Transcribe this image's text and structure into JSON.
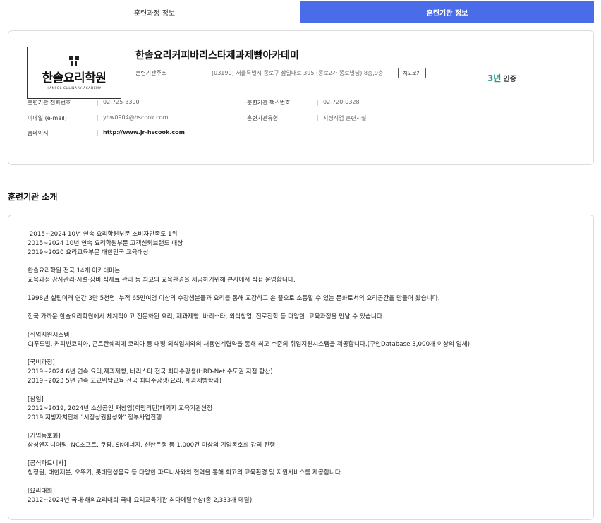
{
  "tabs": [
    {
      "label": "훈련과정 정보",
      "active": false
    },
    {
      "label": "훈련기관 정보",
      "active": true
    }
  ],
  "institution": {
    "logo_name": "한솔요리학원",
    "logo_sub": "HANSOL CULINARY ACADEMY",
    "name": "한솔요리커피바리스타제과제빵아카데미",
    "address_label": "훈련기관주소",
    "address": "(03190) 서울특별시 종로구 삼일대로 395 (종로2가 종로빌딩) 8층,9층",
    "map_button": "지도보기",
    "cert_years": "3년",
    "cert_label": "인증",
    "phone_label": "훈련기관 전화번호",
    "phone": "02-725-3300",
    "fax_label": "훈련기관 팩스번호",
    "fax": "02-720-0328",
    "email_label": "이메일 (e-mail)",
    "email": "yhw0904@hscook.com",
    "type_label": "훈련기관유형",
    "type": "지정직업 훈련시설",
    "homepage_label": "홈페이지",
    "homepage": "http://www.jr-hscook.com"
  },
  "intro": {
    "title": "훈련기관 소개",
    "lines": [
      " 2015~2024 10년 연속 요리학원부문 소비자만족도 1위",
      "2015~2024 10년 연속 요리학원부문 고객신뢰브랜드 대상",
      "2019~2020 요리교육부문 대한민국 교육대상",
      "",
      "한솔요리학원 전국 14개 아카데미는",
      "교육과정·강사관리·시설·장비·식재료 관리 등 최고의 교육환경을 제공하기위해 본사에서 직접 운영합니다.",
      "",
      "1998년 설립이래 연간 3만 5천명, 누적 65만여명 이상의 수강생분들과 요리를 통해 교감하고 손 끝으로 소통할 수 있는 문화로서의 요리공간을 만들어 왔습니다.",
      "",
      "전국 가까운 한솔요리학원에서 체계적이고 전문화된 요리, 제과제빵, 바리스타, 외식창업, 진로진학 등 다양한  교육과정을 만날 수 있습니다.",
      "",
      "[취업지원시스템]",
      "CJ푸드빌, 커피빈코리아, 곤트란쉐리에 코리아 등 대형 외식업체와의 채용연계협약을 통해 최고 수준의 취업지원시스템을 제공합니다.(구인Database 3,000개 이상의 업체)",
      "",
      "[국비과정]",
      "2019~2024 6년 연속 요리,제과제빵, 바리스타 전국 최다수강생(HRD-Net 수도권 지점 합산)",
      "2019~2023 5년 연속 고교위탁교육 전국 최다수강생(요리, 제과제빵학과)",
      "",
      "[창업]",
      "2012~2019, 2024년 소상공인 재창업(희망리턴)패키지 교육기관선정",
      "2019 지방자치단체 \"시장상권활성화\" 정부사업진행",
      "",
      "[기업동호회]",
      "삼성엔지니어링, NC소프트, 쿠팡, SK에너지, 신한은행 등 1,000건 이상의 기업동호회 강의 진행",
      "",
      "[공식파트너사]",
      "청정원, 대한제분, 오뚜기, 롯데칠성음료 등 다양한 파트너사와의 협력을 통해 최고의 교육환경 및 지원서비스를 제공합니다.",
      "",
      "[요리대회]",
      "2012~2024년 국내·해외요리대회 국내 요리교육기관 최다메달수상(총 2,333개 메달)"
    ]
  }
}
